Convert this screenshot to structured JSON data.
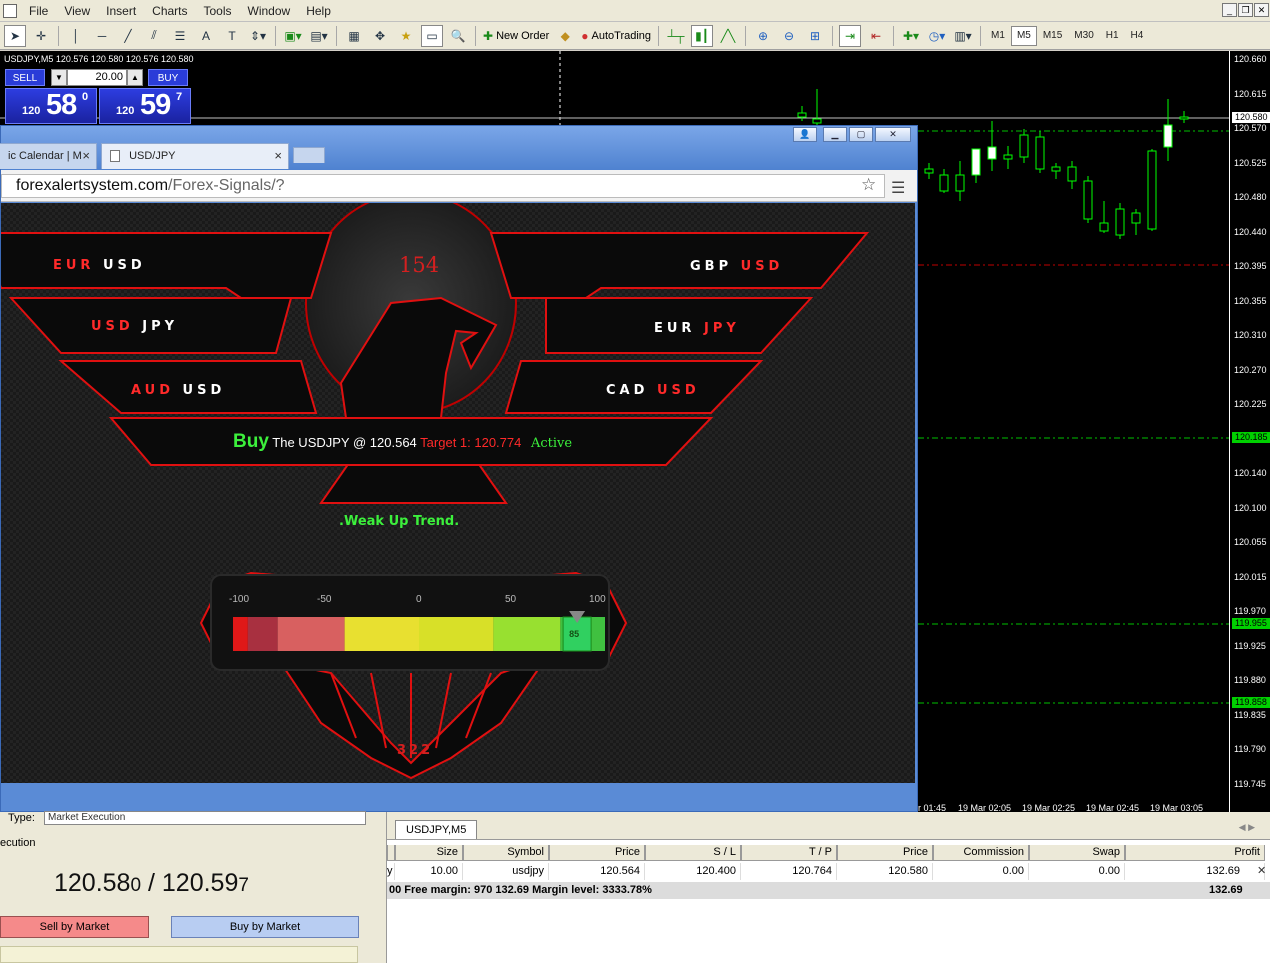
{
  "menu": [
    "File",
    "View",
    "Insert",
    "Charts",
    "Tools",
    "Window",
    "Help"
  ],
  "toolbar": {
    "new_order": "New Order",
    "autotrading": "AutoTrading",
    "timeframes": [
      "M1",
      "M5",
      "M15",
      "M30",
      "H1",
      "H4"
    ],
    "active_timeframe": "M5"
  },
  "chart": {
    "symbol_line": "USDJPY,M5  120.576 120.580 120.576 120.580",
    "price_ticks": [
      "120.660",
      "120.615",
      "120.570",
      "120.525",
      "120.480",
      "120.440",
      "120.395",
      "120.355",
      "120.310",
      "120.270",
      "120.225",
      "120.185",
      "120.140",
      "120.100",
      "120.055",
      "120.015",
      "119.970",
      "119.925",
      "119.880",
      "119.835",
      "119.790",
      "119.745"
    ],
    "price_tags": [
      {
        "label": "120.580",
        "color": "#ffffff",
        "text": "#000000"
      },
      {
        "label": "120.185",
        "color": "#00d000",
        "text": "#000000"
      },
      {
        "label": "119.955",
        "color": "#00d000",
        "text": "#000000"
      },
      {
        "label": "119.858",
        "color": "#00d000",
        "text": "#000000"
      }
    ],
    "time_ticks": [
      "r 01:45",
      "19 Mar 02:05",
      "19 Mar 02:25",
      "19 Mar 02:45",
      "19 Mar 03:05"
    ],
    "colors": {
      "bull": "#ffffff",
      "bear": "#000000",
      "wick": "#00ff00",
      "tp_sl_line": "#00c000",
      "sl_line": "#c00000"
    }
  },
  "oneclick": {
    "sell_label": "SELL",
    "buy_label": "BUY",
    "lot": "20.00",
    "sell_prefix": "120",
    "sell_big": "58",
    "sell_sup": "0",
    "buy_prefix": "120",
    "buy_big": "59",
    "buy_sup": "7"
  },
  "browser": {
    "tab1_label": "ic Calendar | M",
    "tab2_label": "USD/JPY",
    "url_host": "forexalertsystem.com",
    "url_path": "/Forex-Signals/?"
  },
  "page": {
    "pairs": [
      {
        "base": "EUR",
        "quote": "USD"
      },
      {
        "base": "USD",
        "quote": "JPY"
      },
      {
        "base": "AUD",
        "quote": "USD"
      },
      {
        "base": "GBP",
        "quote": "USD"
      },
      {
        "base": "EUR",
        "quote": "JPY"
      },
      {
        "base": "CAD",
        "quote": "USD"
      }
    ],
    "top_counter": "154",
    "bottom_counter": "322",
    "signal": {
      "direction": "Buy",
      "text": "The USDJPY @ 120.564",
      "target": "Target 1: 120.774",
      "status": "Active"
    },
    "trend": ".Weak Up Trend.",
    "gauge": {
      "ticks": [
        "-100",
        "-50",
        "0",
        "50",
        "100"
      ],
      "value": 85,
      "value_label": "85",
      "min": -100,
      "max": 100
    }
  },
  "order_panel": {
    "type_label": "Type:",
    "type_value": "Market Execution",
    "execution_label": "ecution",
    "bid_main": "120.58",
    "bid_small": "0",
    "separator": " / ",
    "ask_main": "120.59",
    "ask_small": "7",
    "sell_button": "Sell by Market",
    "buy_button": "Buy by Market"
  },
  "terminal": {
    "chart_tab": "USDJPY,M5",
    "columns": [
      "",
      "Size",
      "Symbol",
      "Price",
      "S / L",
      "T / P",
      "Price",
      "Commission",
      "Swap",
      "Profit"
    ],
    "row": [
      "y",
      "10.00",
      "usdjpy",
      "120.564",
      "120.400",
      "120.764",
      "120.580",
      "0.00",
      "0.00",
      "132.69"
    ],
    "summary": "00  Free margin: 970 132.69  Margin level: 3333.78%",
    "summary_profit": "132.69"
  }
}
